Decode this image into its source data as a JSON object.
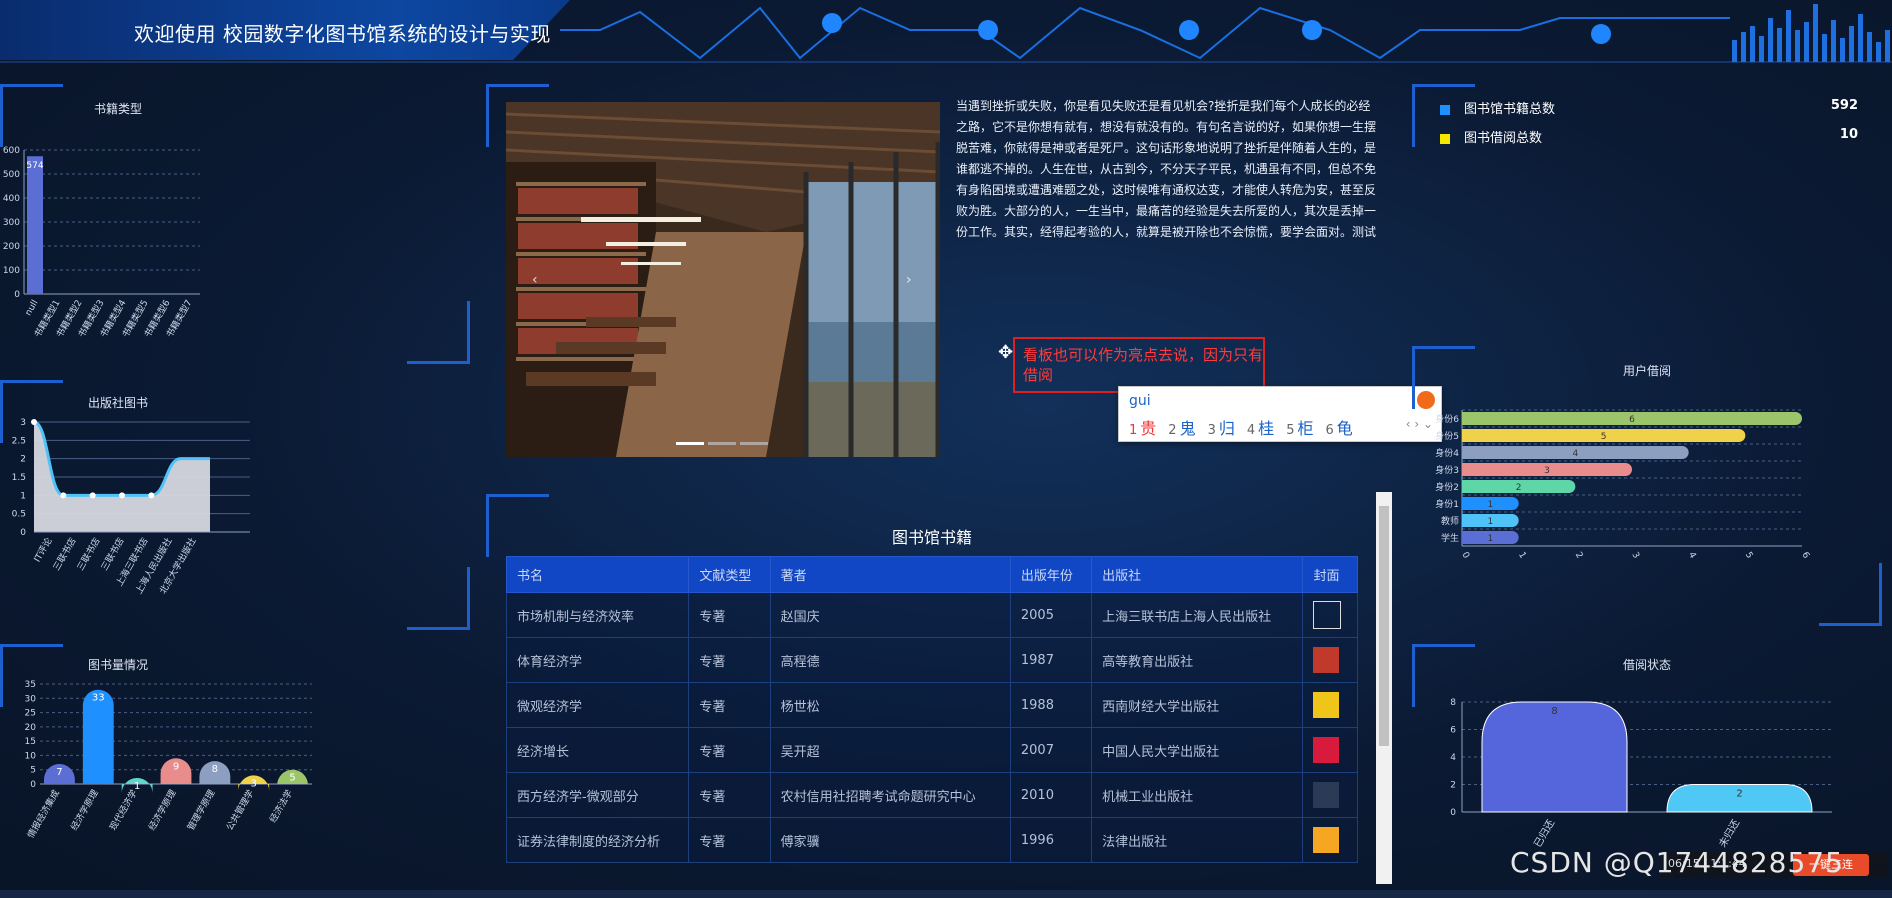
{
  "header": {
    "title": "欢迎使用 校园数字化图书馆系统的设计与实现"
  },
  "book_type_chart": {
    "title": "书籍类型",
    "chart_data": {
      "type": "bar",
      "categories": [
        "null",
        "书籍类型1",
        "书籍类型2",
        "书籍类型3",
        "书籍类型4",
        "书籍类型5",
        "书籍类型6",
        "书籍类型7"
      ],
      "values": [
        574,
        0,
        0,
        0,
        0,
        0,
        0,
        0
      ],
      "data_labels": [
        "574"
      ],
      "ylim": [
        0,
        600
      ],
      "yticks": [
        "0",
        "100",
        "200",
        "300",
        "400",
        "500",
        "600"
      ],
      "yticks_shown": [
        "0",
        "100",
        "200",
        "300",
        "400",
        "500",
        "600"
      ]
    }
  },
  "publisher_chart": {
    "title": "出版社图书",
    "chart_data": {
      "type": "area",
      "categories": [
        "IT评论",
        "三联书店",
        "三联书店",
        "三联书店",
        "上海三联书店",
        "上海人民出版社",
        "北京大学出版社"
      ],
      "values": [
        3,
        1,
        1,
        1,
        1,
        2,
        2
      ],
      "ylim": [
        0,
        3
      ],
      "yticks": [
        "0",
        "0.5",
        "1",
        "1.5",
        "2",
        "2.5",
        "3"
      ]
    }
  },
  "volume_chart": {
    "title": "图书量情况",
    "chart_data": {
      "type": "bar",
      "categories": [
        "情报经济集成",
        "经济学原理",
        "现代经济学",
        "经济学原理",
        "管理学原理",
        "公共管理学",
        "经济法学"
      ],
      "values": [
        7,
        33,
        1,
        9,
        8,
        3,
        5
      ],
      "colors": [
        "#5b6ed4",
        "#1e90ff",
        "#5fd6c8",
        "#e88c8c",
        "#8c9fc0",
        "#f0d24a",
        "#9cc46a"
      ],
      "ylim": [
        0,
        35
      ],
      "yticks": [
        "0",
        "5",
        "10",
        "15",
        "20",
        "25",
        "30",
        "35"
      ]
    }
  },
  "carousel": {
    "prev": "‹",
    "next": "›"
  },
  "intro_text": "当遇到挫折或失败，你是看见失败还是看见机会?挫折是我们每个人成长的必经之路，它不是你想有就有，想没有就没有的。有句名言说的好，如果你想一生摆脱苦难，你就得是神或者是死尸。这句话形象地说明了挫折是伴随着人生的，是谁都逃不掉的。人生在世，从古到今，不分天子平民，机遇虽有不同，但总不免有身陷困境或遭遇难题之处，这时候唯有通权达变，才能使人转危为安，甚至反败为胜。大部分的人，一生当中，最痛苦的经验是失去所爱的人，其次是丢掉一份工作。其实，经得起考验的人，就算是被开除也不会惊慌，要学会面对。测试",
  "annotation": {
    "text": "看板也可以作为亮点去说，因为只有借阅"
  },
  "ime": {
    "input": "gui",
    "candidates": [
      {
        "n": "1",
        "c": "贵"
      },
      {
        "n": "2",
        "c": "鬼"
      },
      {
        "n": "3",
        "c": "归"
      },
      {
        "n": "4",
        "c": "桂"
      },
      {
        "n": "5",
        "c": "柜"
      },
      {
        "n": "6",
        "c": "龟"
      }
    ],
    "nav": "‹ › ⌄"
  },
  "book_table": {
    "title": "图书馆书籍",
    "columns": [
      "书名",
      "文献类型",
      "著者",
      "出版年份",
      "出版社",
      "封面"
    ],
    "rows": [
      [
        "市场机制与经济效率",
        "专著",
        "赵国庆",
        "2005",
        "上海三联书店上海人民出版社"
      ],
      [
        "体育经济学",
        "专著",
        "高程德",
        "1987",
        "高等教育出版社"
      ],
      [
        "微观经济学",
        "专著",
        "杨世松",
        "1988",
        "西南财经大学出版社"
      ],
      [
        "经济增长",
        "专著",
        "吴开超",
        "2007",
        "中国人民大学出版社"
      ],
      [
        "西方经济学-微观部分",
        "专著",
        "农村信用社招聘考试命题研究中心",
        "2010",
        "机械工业出版社"
      ],
      [
        "证券法律制度的经济分析",
        "专著",
        "傅家骥",
        "1996",
        "法律出版社"
      ]
    ],
    "cover_colors": [
      "#ffffff",
      "#c0392b",
      "#f0c419",
      "#d81b3c",
      "#2b3b55",
      "#f5a623"
    ]
  },
  "stats": [
    {
      "label": "图书馆书籍总数",
      "value": "592",
      "color": "#1e90ff"
    },
    {
      "label": "图书借阅总数",
      "value": "10",
      "color": "#f5e800"
    }
  ],
  "user_borrow_chart": {
    "title": "用户借阅",
    "chart_data": {
      "type": "bar",
      "orientation": "horizontal",
      "categories": [
        "学生",
        "教师",
        "身份1",
        "身份2",
        "身份3",
        "身份4",
        "身份5",
        "身份6"
      ],
      "values": [
        1,
        1,
        1,
        2,
        3,
        4,
        5,
        6
      ],
      "colors": [
        "#5b6ed4",
        "#4fc3f7",
        "#1e90ff",
        "#5fd6a8",
        "#e88c8c",
        "#8c9fc0",
        "#f0d24a",
        "#9cc46a"
      ],
      "xlim": [
        0,
        6
      ],
      "xticks": [
        "0",
        "1",
        "2",
        "3",
        "4",
        "5",
        "6"
      ]
    }
  },
  "borrow_status_chart": {
    "title": "借阅状态",
    "chart_data": {
      "type": "bar",
      "categories": [
        "已归还",
        "未归还"
      ],
      "values": [
        8,
        2
      ],
      "colors": [
        "#5566dd",
        "#4fc8f5"
      ],
      "ylim": [
        0,
        8
      ],
      "yticks": [
        "0",
        "2",
        "4",
        "6",
        "8"
      ]
    }
  },
  "watermark": {
    "text": "CSDN @Q1744828575",
    "time": "06:15 / 1:1:44",
    "btn": "一键三连"
  }
}
